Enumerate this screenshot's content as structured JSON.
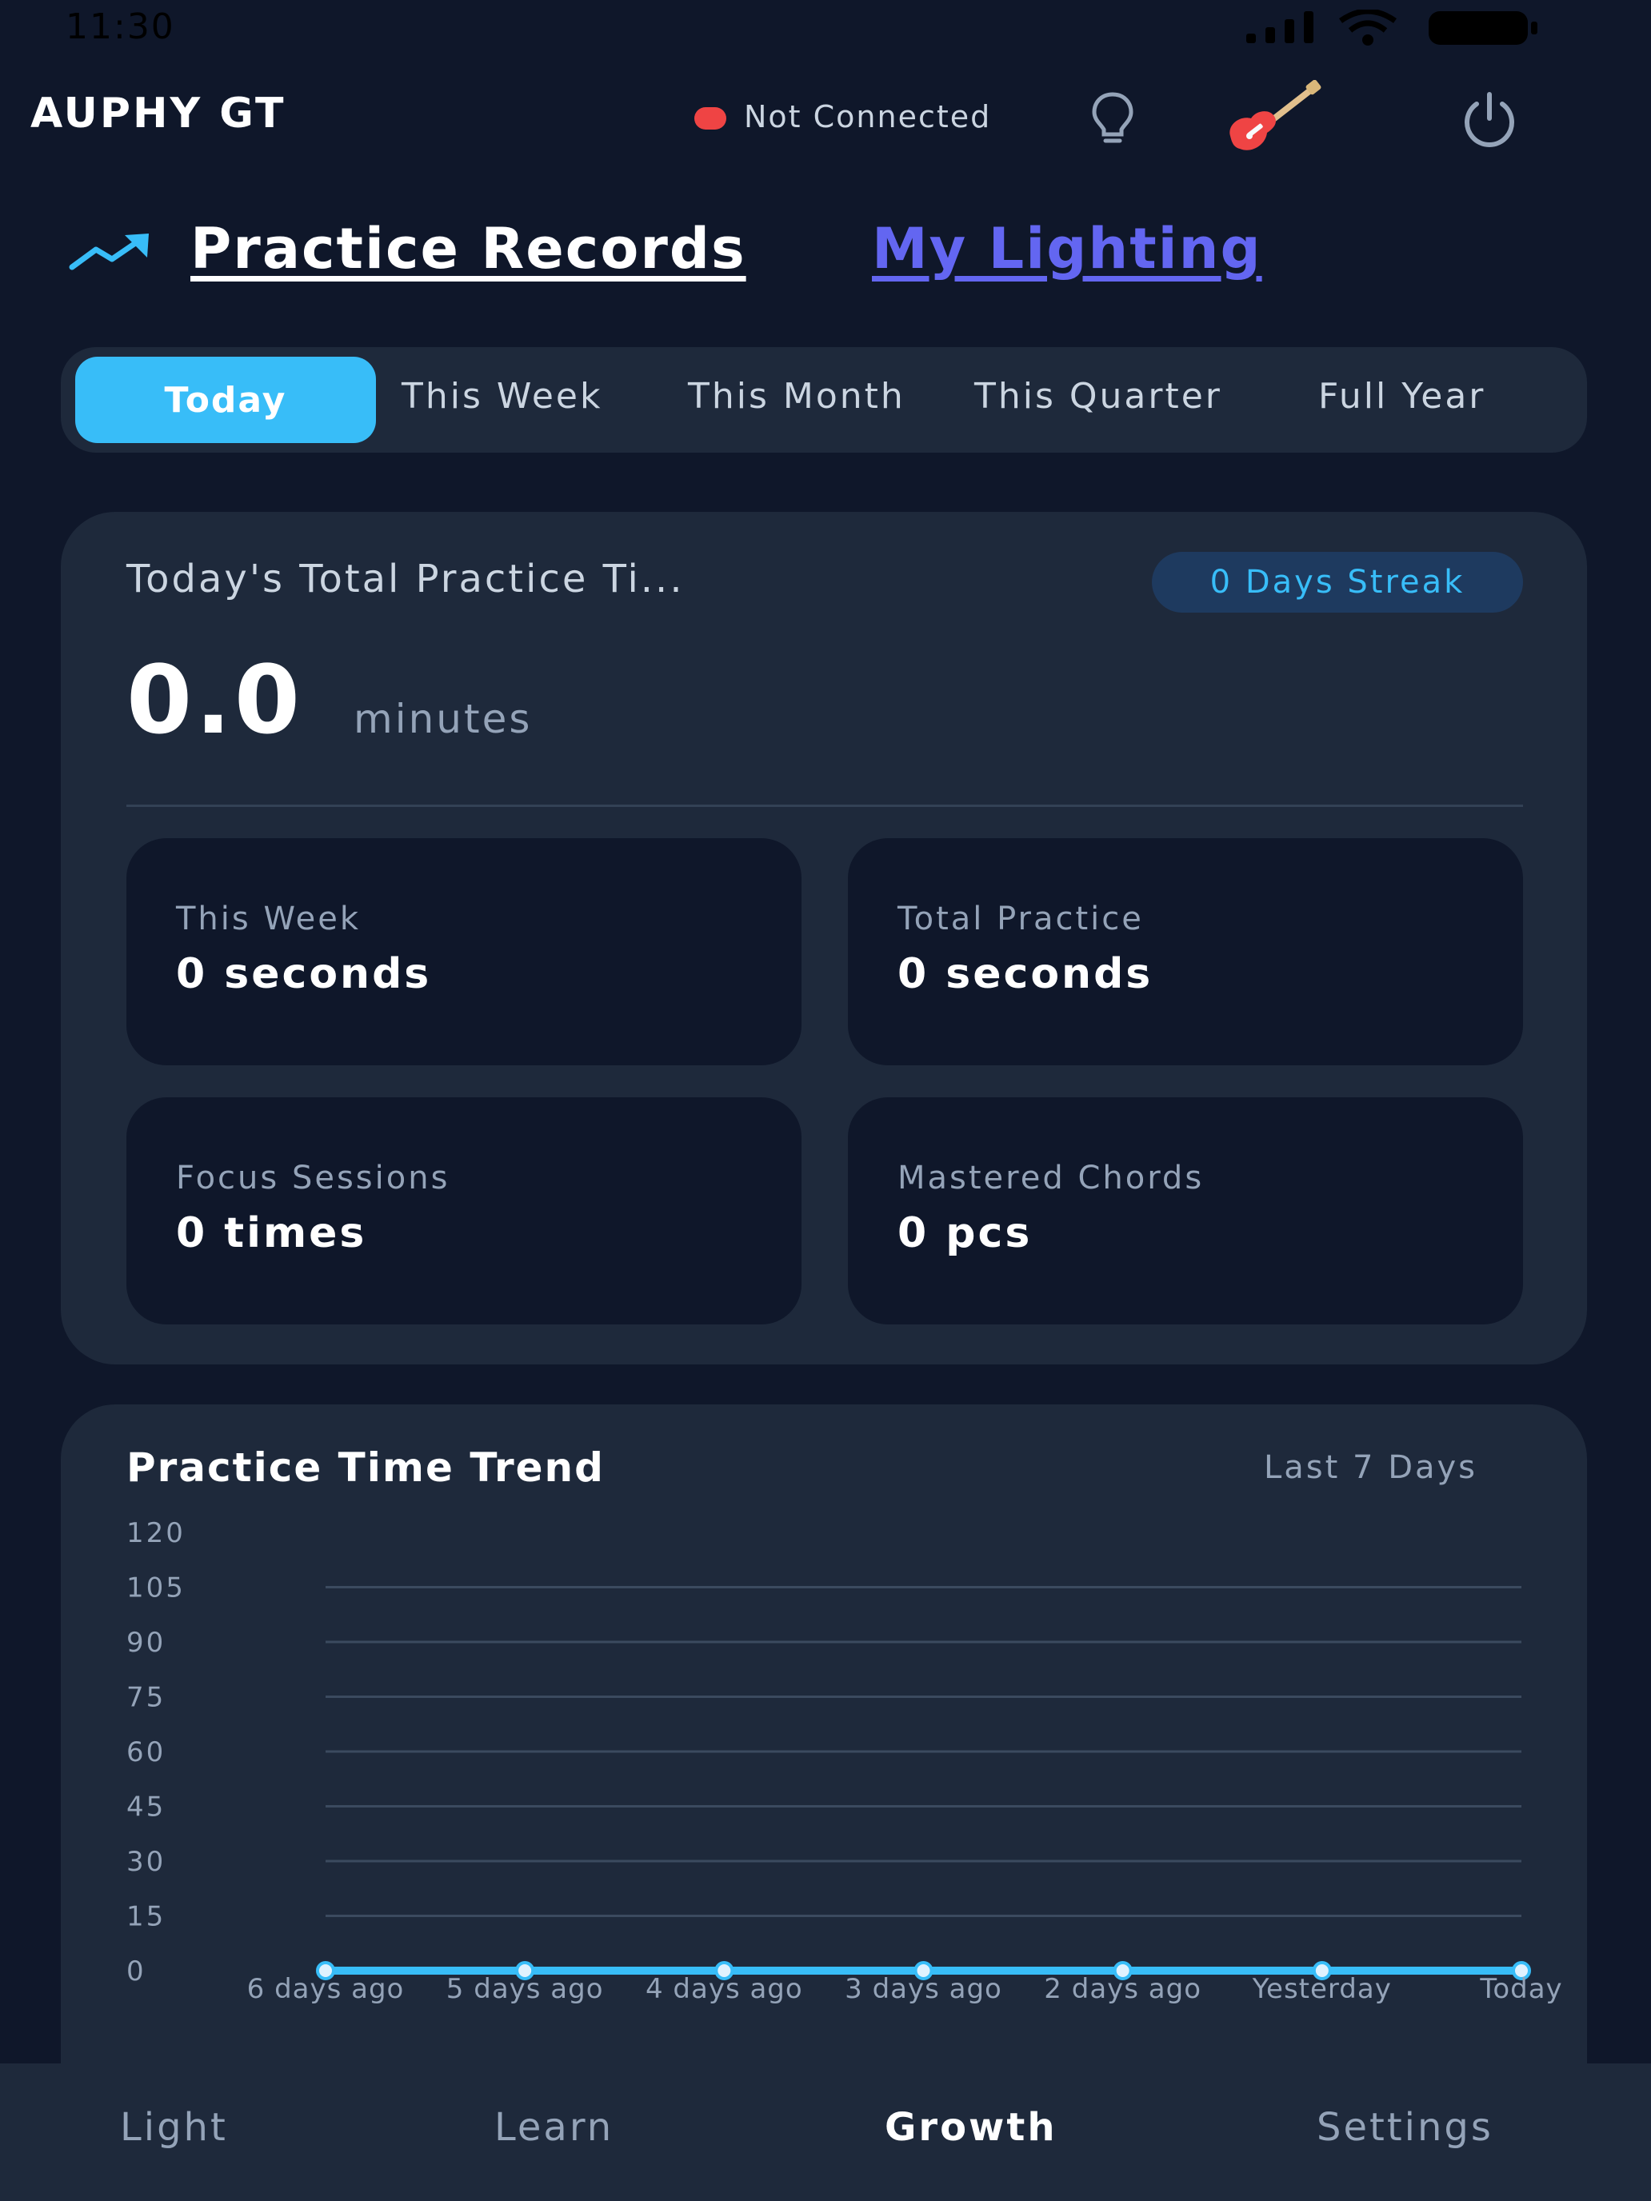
{
  "status_bar": {
    "time": "11:30"
  },
  "header": {
    "app_title": "AUPHY GT",
    "connection_status": "Not Connected",
    "colors": {
      "status_dot": "#ef4444"
    },
    "icons": [
      "bulb-icon",
      "guitar-icon",
      "power-icon"
    ]
  },
  "section_tabs": {
    "active": "Practice Records",
    "other": "My Lighting",
    "icon": "trend-up-icon"
  },
  "period_tabs": {
    "items": [
      "Today",
      "This Week",
      "This Month",
      "This Quarter",
      "Full Year"
    ],
    "selected": "Today"
  },
  "summary": {
    "label": "Today's Total Practice Ti...",
    "streak": "0 Days Streak",
    "value": "0.0",
    "unit": "minutes",
    "stats": [
      {
        "label": "This Week",
        "value": "0 seconds"
      },
      {
        "label": "Total Practice",
        "value": "0 seconds"
      },
      {
        "label": "Focus Sessions",
        "value": "0 times"
      },
      {
        "label": "Mastered Chords",
        "value": "0 pcs"
      }
    ]
  },
  "trend": {
    "title": "Practice Time Trend",
    "range": "Last 7 Days"
  },
  "chart_data": {
    "type": "line",
    "categories": [
      "6 days ago",
      "5 days ago",
      "4 days ago",
      "3 days ago",
      "2 days ago",
      "Yesterday",
      "Today"
    ],
    "values": [
      0,
      0,
      0,
      0,
      0,
      0,
      0
    ],
    "yticks": [
      "120",
      "105",
      "90",
      "75",
      "60",
      "45",
      "30",
      "15",
      "0"
    ],
    "ylim": [
      0,
      120
    ],
    "grid": true,
    "colors": {
      "line": "#38bdf8",
      "grid": "#3b4a5f"
    }
  },
  "bottom_nav": {
    "items": [
      "Light",
      "Learn",
      "Growth",
      "Settings"
    ],
    "active": "Growth"
  }
}
